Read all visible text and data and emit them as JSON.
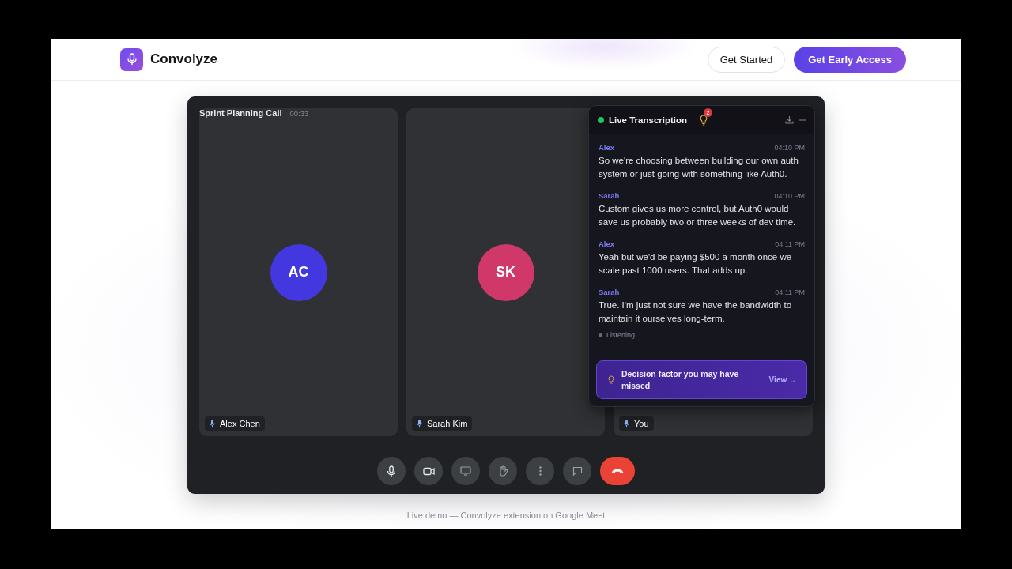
{
  "brand": {
    "name": "Convolyze"
  },
  "nav": {
    "buttons": [
      {
        "label": "Get Started",
        "kind": "outline"
      },
      {
        "label": "Get Early Access",
        "kind": "primary"
      }
    ]
  },
  "call": {
    "title": "Sprint Planning Call",
    "timer": "00:33",
    "tiles": [
      {
        "name": "Alex Chen",
        "initials": "AC",
        "color": "#4338e0"
      },
      {
        "name": "Sarah Kim",
        "initials": "SK",
        "color": "#d0386a"
      },
      {
        "name": "You"
      }
    ],
    "controls": [
      {
        "kind": "mic"
      },
      {
        "kind": "camera"
      },
      {
        "kind": "screen"
      },
      {
        "kind": "hand"
      },
      {
        "kind": "more"
      },
      {
        "kind": "chat"
      },
      {
        "kind": "hangup"
      }
    ]
  },
  "transcription": {
    "title": "Live Transcription",
    "live": true,
    "badge": "2",
    "messages": [
      {
        "speaker": "Alex",
        "time": "04:10 PM",
        "text": "So we're choosing between building our own auth system or just going with something like Auth0."
      },
      {
        "speaker": "Sarah",
        "time": "04:10 PM",
        "text": "Custom gives us more control, but Auth0 would save us probably two or three weeks of dev time."
      },
      {
        "speaker": "Alex",
        "time": "04:11 PM",
        "text": "Yeah but we'd be paying $500 a month once we scale past 1000 users. That adds up."
      },
      {
        "speaker": "Sarah",
        "time": "04:11 PM",
        "text": "True. I'm just not sure we have the bandwidth to maintain it ourselves long-term."
      }
    ],
    "status": "Listening",
    "insight": {
      "text": "Decision factor you may have missed",
      "action": "View →"
    }
  },
  "caption": "Live demo — Convolyze extension on Google Meet"
}
